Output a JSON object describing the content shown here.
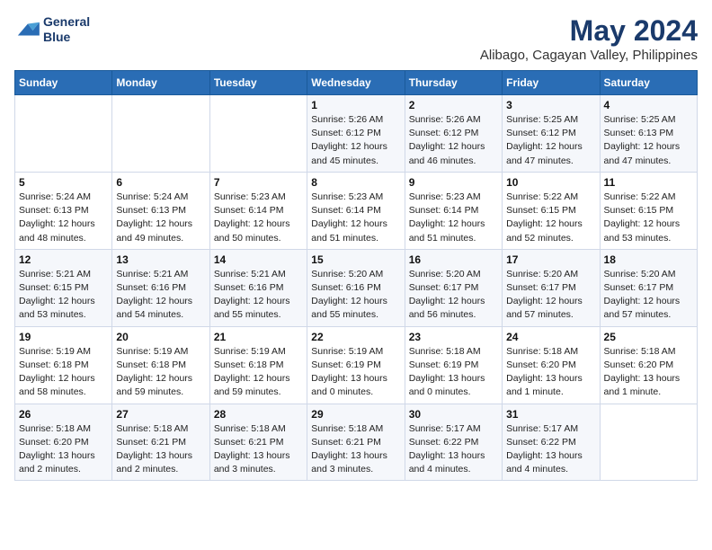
{
  "logo": {
    "line1": "General",
    "line2": "Blue"
  },
  "title": "May 2024",
  "subtitle": "Alibago, Cagayan Valley, Philippines",
  "days_header": [
    "Sunday",
    "Monday",
    "Tuesday",
    "Wednesday",
    "Thursday",
    "Friday",
    "Saturday"
  ],
  "weeks": [
    [
      {
        "num": "",
        "info": ""
      },
      {
        "num": "",
        "info": ""
      },
      {
        "num": "",
        "info": ""
      },
      {
        "num": "1",
        "info": "Sunrise: 5:26 AM\nSunset: 6:12 PM\nDaylight: 12 hours\nand 45 minutes."
      },
      {
        "num": "2",
        "info": "Sunrise: 5:26 AM\nSunset: 6:12 PM\nDaylight: 12 hours\nand 46 minutes."
      },
      {
        "num": "3",
        "info": "Sunrise: 5:25 AM\nSunset: 6:12 PM\nDaylight: 12 hours\nand 47 minutes."
      },
      {
        "num": "4",
        "info": "Sunrise: 5:25 AM\nSunset: 6:13 PM\nDaylight: 12 hours\nand 47 minutes."
      }
    ],
    [
      {
        "num": "5",
        "info": "Sunrise: 5:24 AM\nSunset: 6:13 PM\nDaylight: 12 hours\nand 48 minutes."
      },
      {
        "num": "6",
        "info": "Sunrise: 5:24 AM\nSunset: 6:13 PM\nDaylight: 12 hours\nand 49 minutes."
      },
      {
        "num": "7",
        "info": "Sunrise: 5:23 AM\nSunset: 6:14 PM\nDaylight: 12 hours\nand 50 minutes."
      },
      {
        "num": "8",
        "info": "Sunrise: 5:23 AM\nSunset: 6:14 PM\nDaylight: 12 hours\nand 51 minutes."
      },
      {
        "num": "9",
        "info": "Sunrise: 5:23 AM\nSunset: 6:14 PM\nDaylight: 12 hours\nand 51 minutes."
      },
      {
        "num": "10",
        "info": "Sunrise: 5:22 AM\nSunset: 6:15 PM\nDaylight: 12 hours\nand 52 minutes."
      },
      {
        "num": "11",
        "info": "Sunrise: 5:22 AM\nSunset: 6:15 PM\nDaylight: 12 hours\nand 53 minutes."
      }
    ],
    [
      {
        "num": "12",
        "info": "Sunrise: 5:21 AM\nSunset: 6:15 PM\nDaylight: 12 hours\nand 53 minutes."
      },
      {
        "num": "13",
        "info": "Sunrise: 5:21 AM\nSunset: 6:16 PM\nDaylight: 12 hours\nand 54 minutes."
      },
      {
        "num": "14",
        "info": "Sunrise: 5:21 AM\nSunset: 6:16 PM\nDaylight: 12 hours\nand 55 minutes."
      },
      {
        "num": "15",
        "info": "Sunrise: 5:20 AM\nSunset: 6:16 PM\nDaylight: 12 hours\nand 55 minutes."
      },
      {
        "num": "16",
        "info": "Sunrise: 5:20 AM\nSunset: 6:17 PM\nDaylight: 12 hours\nand 56 minutes."
      },
      {
        "num": "17",
        "info": "Sunrise: 5:20 AM\nSunset: 6:17 PM\nDaylight: 12 hours\nand 57 minutes."
      },
      {
        "num": "18",
        "info": "Sunrise: 5:20 AM\nSunset: 6:17 PM\nDaylight: 12 hours\nand 57 minutes."
      }
    ],
    [
      {
        "num": "19",
        "info": "Sunrise: 5:19 AM\nSunset: 6:18 PM\nDaylight: 12 hours\nand 58 minutes."
      },
      {
        "num": "20",
        "info": "Sunrise: 5:19 AM\nSunset: 6:18 PM\nDaylight: 12 hours\nand 59 minutes."
      },
      {
        "num": "21",
        "info": "Sunrise: 5:19 AM\nSunset: 6:18 PM\nDaylight: 12 hours\nand 59 minutes."
      },
      {
        "num": "22",
        "info": "Sunrise: 5:19 AM\nSunset: 6:19 PM\nDaylight: 13 hours\nand 0 minutes."
      },
      {
        "num": "23",
        "info": "Sunrise: 5:18 AM\nSunset: 6:19 PM\nDaylight: 13 hours\nand 0 minutes."
      },
      {
        "num": "24",
        "info": "Sunrise: 5:18 AM\nSunset: 6:20 PM\nDaylight: 13 hours\nand 1 minute."
      },
      {
        "num": "25",
        "info": "Sunrise: 5:18 AM\nSunset: 6:20 PM\nDaylight: 13 hours\nand 1 minute."
      }
    ],
    [
      {
        "num": "26",
        "info": "Sunrise: 5:18 AM\nSunset: 6:20 PM\nDaylight: 13 hours\nand 2 minutes."
      },
      {
        "num": "27",
        "info": "Sunrise: 5:18 AM\nSunset: 6:21 PM\nDaylight: 13 hours\nand 2 minutes."
      },
      {
        "num": "28",
        "info": "Sunrise: 5:18 AM\nSunset: 6:21 PM\nDaylight: 13 hours\nand 3 minutes."
      },
      {
        "num": "29",
        "info": "Sunrise: 5:18 AM\nSunset: 6:21 PM\nDaylight: 13 hours\nand 3 minutes."
      },
      {
        "num": "30",
        "info": "Sunrise: 5:17 AM\nSunset: 6:22 PM\nDaylight: 13 hours\nand 4 minutes."
      },
      {
        "num": "31",
        "info": "Sunrise: 5:17 AM\nSunset: 6:22 PM\nDaylight: 13 hours\nand 4 minutes."
      },
      {
        "num": "",
        "info": ""
      }
    ]
  ]
}
